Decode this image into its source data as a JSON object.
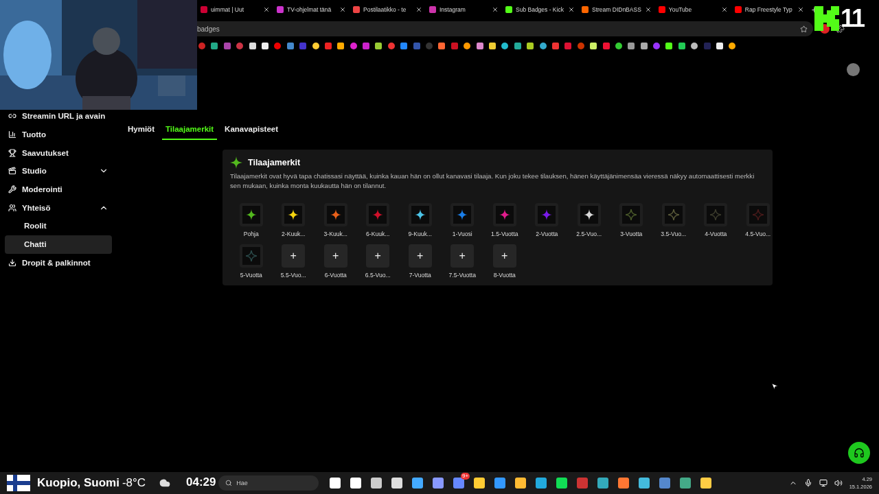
{
  "browser": {
    "tabs": [
      {
        "title": "uimmat | Uut"
      },
      {
        "title": "TV-ohjelmat tänä"
      },
      {
        "title": "Postilaatikko - te"
      },
      {
        "title": "Instagram"
      },
      {
        "title": "Sub Badges - Kick"
      },
      {
        "title": "Stream DIDnBASS"
      },
      {
        "title": "YouTube"
      },
      {
        "title": "Rap Freestyle Typ"
      }
    ],
    "new_tab": "+",
    "address": "badges"
  },
  "stream_overlay": {
    "counter": "11",
    "time": "04:29"
  },
  "sidebar": {
    "items": [
      {
        "label": "Streamin URL ja avain",
        "selected": false
      },
      {
        "label": "Tuotto",
        "selected": false
      },
      {
        "label": "Saavutukset",
        "selected": false
      },
      {
        "label": "Studio",
        "expanded": false,
        "selected": false
      },
      {
        "label": "Moderointi",
        "selected": false
      },
      {
        "label": "Yhteisö",
        "expanded": true,
        "selected": false,
        "children": [
          {
            "label": "Roolit",
            "selected": false
          },
          {
            "label": "Chatti",
            "selected": true
          }
        ]
      },
      {
        "label": "Dropit & palkinnot",
        "selected": false
      }
    ]
  },
  "subtabs": [
    {
      "label": "Hymiöt",
      "selected": false
    },
    {
      "label": "Tilaajamerkit",
      "selected": true
    },
    {
      "label": "Kanavapisteet",
      "selected": false
    }
  ],
  "card": {
    "title": "Tilaajamerkit",
    "description": "Tilaajamerkit ovat hyvä tapa chatissasi näyttää, kuinka kauan hän on ollut kanavasi tilaaja. Kun joku tekee tilauksen, hänen käyttäjänimensäa vieressä näkyy automaattisesti merkki sen mukaan, kuinka monta kuukautta hän on tilannut.",
    "badges": [
      {
        "label": "Pohja",
        "kind": "star",
        "color": "#53b81e"
      },
      {
        "label": "2-Kuuk...",
        "kind": "star",
        "color": "#f5d40f"
      },
      {
        "label": "3-Kuuk...",
        "kind": "star",
        "color": "#e8601a"
      },
      {
        "label": "6-Kuuk...",
        "kind": "star",
        "color": "#d0102a"
      },
      {
        "label": "9-Kuuk...",
        "kind": "star",
        "color": "#4cc4e8"
      },
      {
        "label": "1-Vuosi",
        "kind": "star",
        "color": "#1a7ee8"
      },
      {
        "label": "1.5-Vuotta",
        "kind": "star",
        "color": "#e01c8c"
      },
      {
        "label": "2-Vuotta",
        "kind": "star",
        "color": "#7a1ae8"
      },
      {
        "label": "2.5-Vuo...",
        "kind": "star",
        "color": "#d8d8d8"
      },
      {
        "label": "3-Vuotta",
        "kind": "outline",
        "color": "#4a5a2a"
      },
      {
        "label": "3.5-Vuo...",
        "kind": "outline",
        "color": "#5a5a3a"
      },
      {
        "label": "4-Vuotta",
        "kind": "outline",
        "color": "#3c3c2c"
      },
      {
        "label": "4.5-Vuo...",
        "kind": "outline",
        "color": "#4a1a1a"
      },
      {
        "label": "5-Vuotta",
        "kind": "outline",
        "color": "#2a4a4a"
      },
      {
        "label": "5.5-Vuo...",
        "kind": "add",
        "add": "+"
      },
      {
        "label": "6-Vuotta",
        "kind": "add",
        "add": "+"
      },
      {
        "label": "6.5-Vuo...",
        "kind": "add",
        "add": "+"
      },
      {
        "label": "7-Vuotta",
        "kind": "add",
        "add": "+"
      },
      {
        "label": "7.5-Vuotta",
        "kind": "add",
        "add": "+"
      },
      {
        "label": "8-Vuotta",
        "kind": "add",
        "add": "+"
      }
    ]
  },
  "taskbar": {
    "weather_place": "Kuopio, Suomi",
    "temperature": "-8°C",
    "search": {
      "placeholder": "Hae"
    },
    "notification_count": "9+",
    "clock": "4.29",
    "date": "15.1.2026"
  }
}
